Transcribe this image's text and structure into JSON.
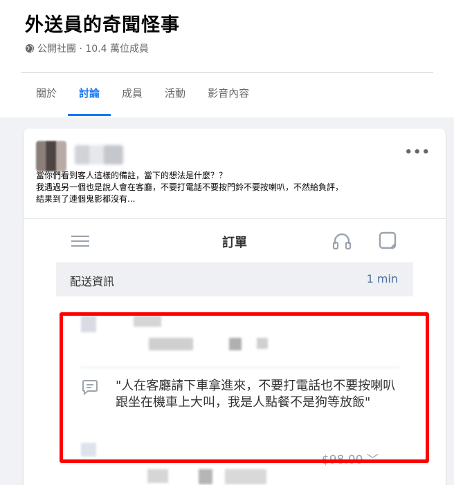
{
  "group": {
    "title": "外送員的奇聞怪事",
    "meta": "公開社團 · 10.4 萬位成員",
    "tabs": [
      {
        "label": "關於",
        "active": false
      },
      {
        "label": "討論",
        "active": true
      },
      {
        "label": "成員",
        "active": false
      },
      {
        "label": "活動",
        "active": false
      },
      {
        "label": "影音內容",
        "active": false
      }
    ]
  },
  "colors": {
    "accent": "#1877f2",
    "highlight_box": "#ff0000",
    "section_time": "#4a6f9c"
  },
  "post": {
    "text_lines": [
      "當你們看到客人這樣的備註，當下的想法是什麼？？",
      "我遇過另一個也是說人會在客廳，不要打電話不要按門鈴不要按喇叭，不然給負評，",
      "結果到了連個鬼影都沒有..."
    ],
    "more_icon": "more-horizontal-icon"
  },
  "embedded_app": {
    "nav_title": "訂單",
    "section_title": "配送資訊",
    "section_time": "1 min",
    "note_text": "\"人在客廳請下車拿進來，不要打電話也不要按喇叭跟坐在機車上大叫，我是人點餐不是狗等放飯\"",
    "price_text": "$98.00 ﹀"
  }
}
